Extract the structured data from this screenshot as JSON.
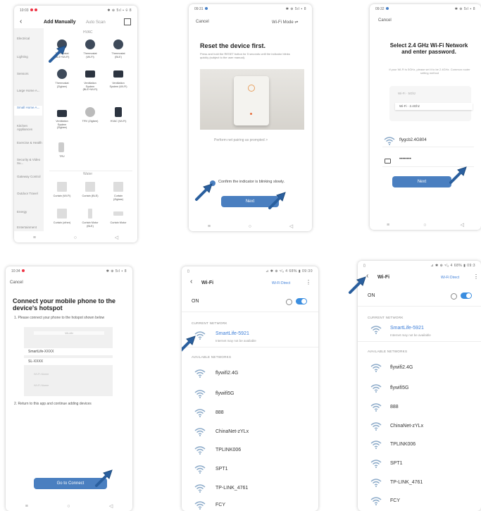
{
  "colors": {
    "accent": "#4a7fc0",
    "arrow": "#2a5f9e",
    "wifi": "#3b7dd8",
    "toggle": "#3b8ee0"
  },
  "p1": {
    "status_time": "10:03",
    "status_right": "✱ ⊕ 5ıl ▪ ⌾ 8",
    "title": "Add Manually",
    "tab2": "Auto Scan",
    "section_hvac": "HVAC",
    "section_water": "Water",
    "categories": [
      "Electrical",
      "Lighting",
      "Sensors",
      "Large Home A...",
      "Small Home A...",
      "Kitchen Appliances",
      "Exercise & Health",
      "Security & Video Su...",
      "Gateway Control",
      "Outdoor Travel",
      "Energy",
      "Entertainment"
    ],
    "devices": [
      {
        "label": "Thermostat (BLE+Wi-Fi)"
      },
      {
        "label": "Thermostat (Wi-Fi)"
      },
      {
        "label": "Thermostat (BLE)"
      },
      {
        "label": "Thermostat (Zigbee)"
      },
      {
        "label": "Ventilation System (BLE+Wi-Fi)"
      },
      {
        "label": "Ventilation System (Wi-Fi)"
      },
      {
        "label": "Ventilation System (Zigbee)"
      },
      {
        "label": "TRV (Zigbee)"
      },
      {
        "label": "HVAC (Wi-Fi)"
      },
      {
        "label": "TRV"
      }
    ],
    "curtains": [
      {
        "label": "Curtain (Wi-Fi)"
      },
      {
        "label": "Curtain (BLE)"
      },
      {
        "label": "Curtain (Zigbee)"
      },
      {
        "label": "Curtain (other)"
      },
      {
        "label": "Curtain Motor (BLE)"
      },
      {
        "label": "Curtain Motor"
      }
    ]
  },
  "p2": {
    "status_time": "09:31",
    "status_right": "✱ ⊕ 5ıl ▪ 8",
    "cancel": "Cancel",
    "mode": "Wi-Fi Mode ⇌",
    "title": "Reset the device first.",
    "body": "Press and hold the RESET button for 5 seconds until the indicator blinks quickly (subject to the user manual).",
    "link": "Perform net pairing as prompted >",
    "confirm": "Confirm the indicator is blinking slowly.",
    "next": "Next"
  },
  "p3": {
    "status_time": "09:32",
    "status_right": "✱ ⊕ 5ıl ▪ 8",
    "cancel": "Cancel",
    "title": "Select 2.4 GHz Wi-Fi Network and enter password.",
    "sub": "If your Wi-Fi is 5GHz, please set it to be 2.4GHz. Common router setting method",
    "ssid": "flygcb2.4G804",
    "password": "••••••••",
    "next": "Next",
    "mini_row1": "Wi-Fi · 5Ghz",
    "mini_row2": "Wi-Fi · 2.4Ghz"
  },
  "p4": {
    "status_time": "10:34",
    "status_right": "✱ ⊕ 5ıl ▪ 8",
    "cancel": "Cancel",
    "title": "Connect your mobile phone to the device's hotspot",
    "step1": "1. Please connect your phone to the hotspot shown below",
    "mini_header": "WLAN",
    "mini_row1": "SmartLife-XXXX",
    "mini_row2": "SL-XXXX",
    "mini_row3": "Wi-Fi-Name",
    "mini_row4": "Wi-Fi-Name",
    "step2": "2. Return to this app and continue adding devices",
    "button": "Go to Connect"
  },
  "p5": {
    "status_right": "⊿ ✱ ⊕ ⁵⁄₈ 4 68% ▮ 09:30",
    "title": "Wi-Fi",
    "wifi_direct": "Wi-Fi Direct",
    "on": "ON",
    "current_label": "CURRENT NETWORK",
    "current_name": "SmartLife-5921",
    "current_sub": "Internet may not be available",
    "available_label": "AVAILABLE NETWORKS",
    "networks": [
      "flywifi2.4G",
      "flywifi5G",
      "888",
      "ChinaNet-zYLx",
      "TPLINK006",
      "SPT1",
      "TP-LINK_4761",
      "FCY"
    ]
  },
  "p6": {
    "status_right": "⊿ ✱ ⊕ ⁵⁄₈ 4 68% ▮ 09:3",
    "title": "Wi-Fi",
    "wifi_direct": "Wi-Fi Direct",
    "on": "ON",
    "current_label": "CURRENT NETWORK",
    "current_name": "SmartLife-5921",
    "current_sub": "Internet may not be available",
    "available_label": "AVAILABLE NETWORKS",
    "networks": [
      "flywifi2.4G",
      "flywifi5G",
      "888",
      "ChinaNet-zYLx",
      "TPLINK006",
      "SPT1",
      "TP-LINK_4761",
      "FCY"
    ]
  }
}
